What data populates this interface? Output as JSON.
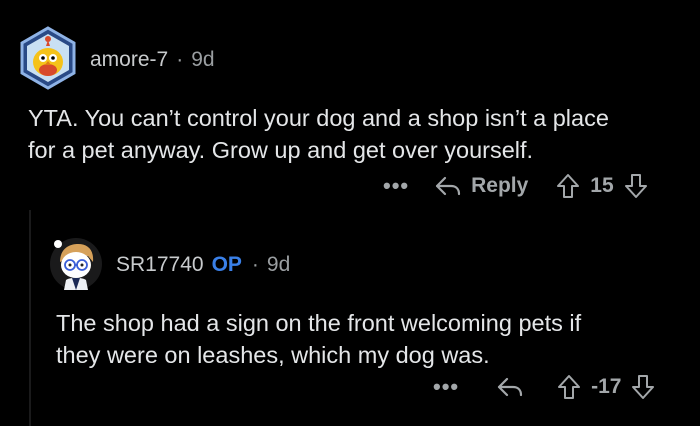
{
  "comment1": {
    "username": "amore-7",
    "age": "9d",
    "body": "YTA. You can’t control your dog and a shop isn’t a place\nfor a pet anyway. Grow up and get over yourself.",
    "more_label": "•••",
    "reply_label": "Reply",
    "score": "15"
  },
  "comment2": {
    "username": "SR17740",
    "op_badge": "OP",
    "age": "9d",
    "body": "The shop had a sign on the front welcoming pets if\nthey were on leashes, which my dog was.",
    "more_label": "•••",
    "score": "-17"
  },
  "colors": {
    "background": "#000000",
    "op": "#3a80e8",
    "text": "#e4e6e8",
    "muted": "#9a9ea1"
  }
}
